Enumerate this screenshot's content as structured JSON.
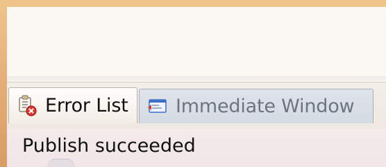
{
  "tabs": [
    {
      "label": "Error List",
      "icon": "error-list-icon",
      "state": "active"
    },
    {
      "label": "Immediate Window",
      "icon": "immediate-window-icon",
      "state": "inactive"
    }
  ],
  "status": {
    "message": "Publish succeeded"
  },
  "colors": {
    "frame": "#e7b079",
    "window": "#f7f3ee",
    "tab_active_text": "#111111",
    "tab_inactive_text": "#6b7480",
    "status_background": "#f4eaea",
    "error_accent": "#d93a2f",
    "window_icon_blue": "#3c6fc9"
  }
}
